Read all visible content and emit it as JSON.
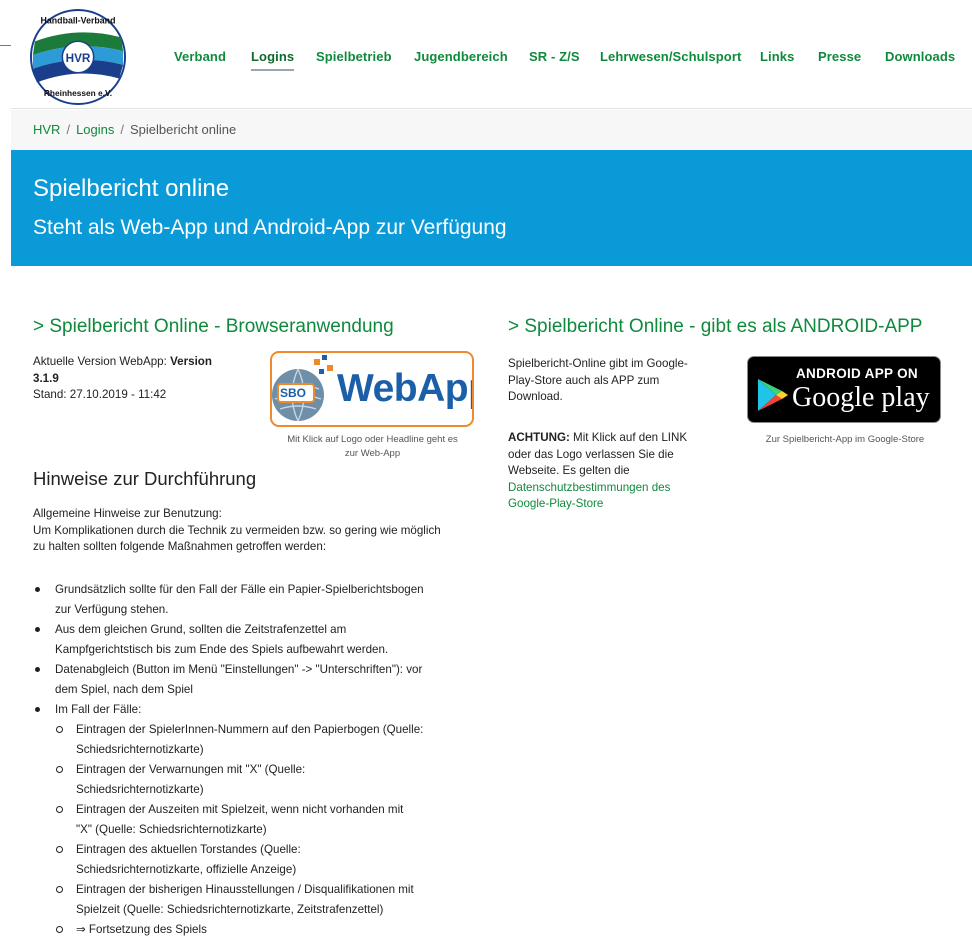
{
  "logo": {
    "top_text": "Handball-Verband",
    "center_text": "HVR",
    "bottom_text": "Rheinhessen e.V."
  },
  "nav": {
    "items": [
      {
        "label": "Verband"
      },
      {
        "label": "Logins",
        "active": true
      },
      {
        "label": "Spielbetrieb"
      },
      {
        "label": "Jugendbereich"
      },
      {
        "label": "SR - Z/S"
      },
      {
        "label": "Lehrwesen/Schulsport"
      },
      {
        "label": "Links"
      },
      {
        "label": "Presse"
      },
      {
        "label": "Downloads"
      }
    ]
  },
  "breadcrumb": {
    "items": [
      "HVR",
      "Logins",
      "Spielbericht online"
    ],
    "separator": "/"
  },
  "hero": {
    "title": "Spielbericht online",
    "subtitle": "Steht als Web-App und Android-App zur Verfügung"
  },
  "left": {
    "heading": "> Spielbericht Online - Browseranwendung",
    "version_label": "Aktuelle Version WebApp: ",
    "version_bold_1": "Version",
    "version_bold_2": "3.1.9",
    "stand": "Stand: 27.10.2019 - 11:42",
    "webapp_logo": {
      "sbo": "SBO",
      "word": "WebApp"
    },
    "logo_caption_1": "Mit Klick auf Logo oder Headline geht es",
    "logo_caption_2": "zur Web-App",
    "section_title": "Hinweise zur Durchführung",
    "intro_1": "Allgemeine Hinweise zur Benutzung:",
    "intro_2": "Um Komplikationen durch die Technik zu vermeiden bzw. so gering wie möglich",
    "intro_3": "zu halten sollten folgende Maßnahmen getroffen werden:",
    "bullets": [
      {
        "lines": [
          "Grundsätzlich sollte für den Fall der Fälle ein Papier-Spielberichtsbogen",
          "zur Verfügung stehen."
        ]
      },
      {
        "lines": [
          "Aus dem gleichen Grund, sollten die Zeitstrafenzettel am",
          "Kampfgerichtstisch bis zum Ende des Spiels aufbewahrt werden."
        ]
      },
      {
        "lines": [
          "Datenabgleich (Button im Menü \"Einstellungen\" -> \"Unterschriften\"): vor",
          "dem Spiel, nach dem Spiel"
        ]
      },
      {
        "lines": [
          "Im Fall der Fälle:"
        ]
      }
    ],
    "sub_bullets": [
      {
        "lines": [
          "Eintragen der SpielerInnen-Nummern auf den Papierbogen (Quelle:",
          "Schiedsrichternotizkarte)"
        ]
      },
      {
        "lines": [
          "Eintragen der Verwarnungen mit \"X\" (Quelle:",
          "Schiedsrichternotizkarte)"
        ]
      },
      {
        "lines": [
          "Eintragen der Auszeiten mit Spielzeit, wenn nicht vorhanden mit",
          "\"X\" (Quelle: Schiedsrichternotizkarte)"
        ]
      },
      {
        "lines": [
          "Eintragen des aktuellen Torstandes (Quelle:",
          "Schiedsrichternotizkarte, offizielle Anzeige)"
        ]
      },
      {
        "lines": [
          "Eintragen der bisherigen Hinausstellungen / Disqualifikationen mit",
          "Spielzeit (Quelle: Schiedsrichternotizkarte, Zeitstrafenzettel)"
        ]
      },
      {
        "lines": [
          "⇒ Fortsetzung des Spiels"
        ]
      }
    ]
  },
  "right": {
    "heading": "> Spielbericht Online - gibt es als ANDROID-APP",
    "p1_1": "Spielbericht-Online gibt im Google-",
    "p1_2": "Play-Store auch als APP zum",
    "p1_3": "Download.",
    "p2_bold": "ACHTUNG:",
    "p2_1": " Mit Klick auf den LINK",
    "p2_2": "oder das Logo verlassen Sie die",
    "p2_3": "Webseite. Es gelten die",
    "p2_link_1": "Datenschutzbestimmungen des",
    "p2_link_2": "Google-Play-Store",
    "badge_top": "ANDROID APP ON",
    "badge_bottom": "Google play",
    "badge_caption": "Zur Spielbericht-App im Google-Store"
  },
  "colors": {
    "brand_green": "#0f8a3c",
    "hero_blue": "#0b9ad8",
    "webapp_orange": "#ee8a2d"
  }
}
